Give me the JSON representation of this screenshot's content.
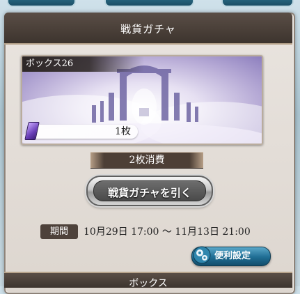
{
  "panel": {
    "title": "戦貨ガチャ"
  },
  "banner": {
    "box_label": "ボックス26",
    "count": "1枚",
    "medal_icon": "currency-medal-icon"
  },
  "cost": {
    "label": "2枚消費"
  },
  "draw": {
    "label": "戦貨ガチャを引く"
  },
  "period": {
    "badge": "期間",
    "text": "10月29日 17:00 〜 11月13日 21:00"
  },
  "settings": {
    "label": "便利設定",
    "icon": "gear-icon"
  },
  "next_panel": {
    "title": "ボックス"
  },
  "colors": {
    "header": "#3d342e",
    "settings_button": "#1f6d93",
    "panel_bg": "#e9e4df"
  }
}
